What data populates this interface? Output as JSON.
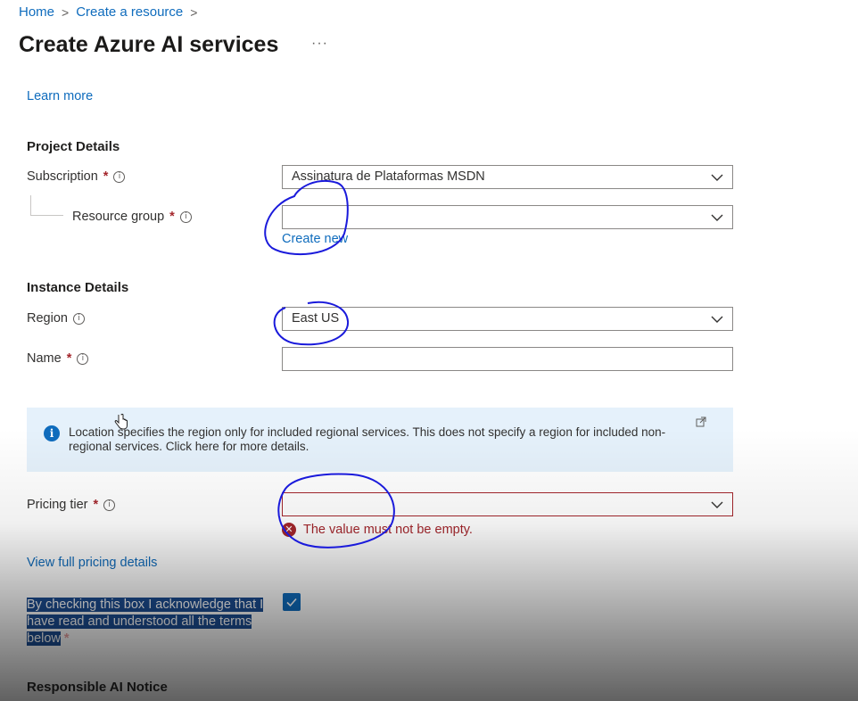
{
  "breadcrumb": {
    "items": [
      "Home",
      "Create a resource"
    ],
    "separator": ">"
  },
  "page": {
    "title": "Create Azure AI services",
    "more": "···",
    "learn_more": "Learn more"
  },
  "project_details": {
    "title": "Project Details",
    "subscription": {
      "label": "Subscription",
      "required": "*",
      "value": "Assinatura de Plataformas MSDN"
    },
    "resource_group": {
      "label": "Resource group",
      "required": "*",
      "value": "",
      "create_new": "Create new"
    }
  },
  "instance_details": {
    "title": "Instance Details",
    "region": {
      "label": "Region",
      "value": "East US"
    },
    "name": {
      "label": "Name",
      "required": "*",
      "value": ""
    }
  },
  "notice": {
    "text": "Location specifies the region only for included regional services. This does not specify a region for included non-regional services. Click here for more details."
  },
  "pricing": {
    "label": "Pricing tier",
    "required": "*",
    "value": "",
    "error": "The value must not be empty.",
    "view_details": "View full pricing details"
  },
  "acknowledge": {
    "text": "By checking this box I acknowledge that I have read and understood all the terms below",
    "required": "*",
    "checked": true
  },
  "next_section": {
    "title": "Responsible AI Notice"
  },
  "colors": {
    "link": "#0f6cbd",
    "error": "#a4262c",
    "notice_bg": "#e5f1fb",
    "annotation": "#1a1adb"
  }
}
